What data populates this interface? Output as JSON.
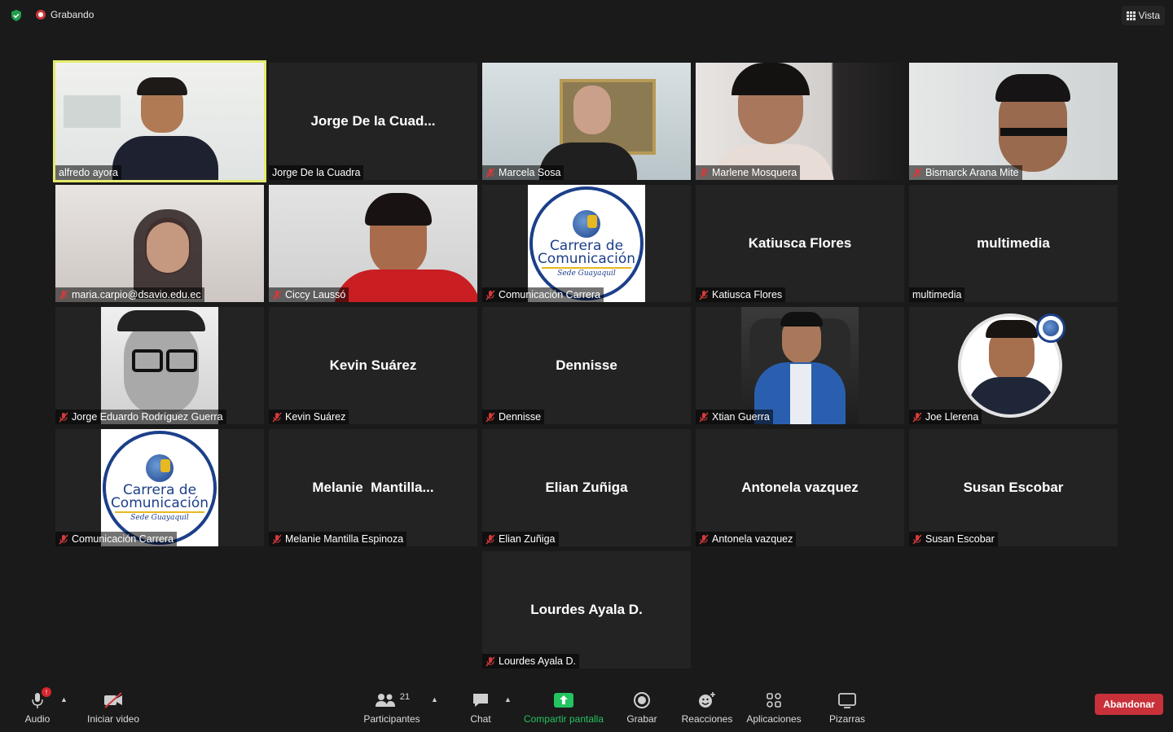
{
  "topbar": {
    "recording_label": "Grabando",
    "view_label": "Vista"
  },
  "tiles": [
    {
      "name": "alfredo ayora"
    },
    {
      "display": "Jorge De la Cuad...",
      "name": "Jorge De la Cuadra"
    },
    {
      "name": "Marcela Sosa"
    },
    {
      "name": "Marlene Mosquera"
    },
    {
      "name": "Bismarck Arana Mite"
    },
    {
      "name": "maria.carpio@dsavio.edu.ec"
    },
    {
      "name": "Ciccy Laussó"
    },
    {
      "name": "Comunicación Carrera"
    },
    {
      "display": "Katiusca Flores",
      "name": "Katiusca Flores"
    },
    {
      "display": "multimedia",
      "name": "multimedia"
    },
    {
      "name": "Jorge Eduardo Rodríguez Guerra"
    },
    {
      "display": "Kevin Suárez",
      "name": "Kevin Suárez"
    },
    {
      "display": "Dennisse",
      "name": "Dennisse"
    },
    {
      "name": "Xtian Guerra"
    },
    {
      "name": "Joe Llerena"
    },
    {
      "name": "Comunicación Carrera"
    },
    {
      "display": "Melanie  Mantilla...",
      "name": "Melanie Mantilla Espinoza"
    },
    {
      "display": "Elian Zuñiga",
      "name": "Elian Zuñiga"
    },
    {
      "display": "Antonela vazquez",
      "name": "Antonela vazquez"
    },
    {
      "display": "Susan Escobar",
      "name": "Susan Escobar"
    },
    {
      "display": "Lourdes Ayala D.",
      "name": "Lourdes Ayala D."
    }
  ],
  "logo": {
    "line1": "Carrera de",
    "line2": "Comunicación",
    "line3": "Sede Guayaquil"
  },
  "toolbar": {
    "audio": "Audio",
    "audio_badge": "!",
    "video": "Iniciar video",
    "participants": "Participantes",
    "participants_count": "21",
    "chat": "Chat",
    "share": "Compartir pantalla",
    "record": "Grabar",
    "reactions": "Reacciones",
    "apps": "Aplicaciones",
    "whiteboards": "Pizarras",
    "leave": "Abandonar"
  },
  "colors": {
    "active_speaker_border": "#e3ea6c",
    "leave_button": "#c8313a",
    "share_green": "#23c35f",
    "mute_red": "#d23b3b",
    "logo_blue": "#1c3f8a",
    "logo_gold": "#e7b821"
  }
}
